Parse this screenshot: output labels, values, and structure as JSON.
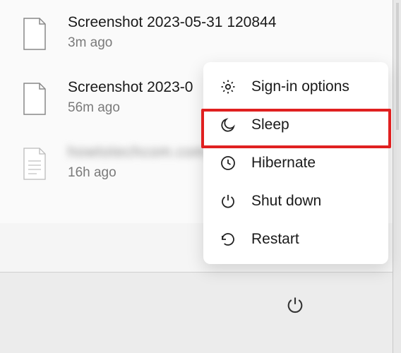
{
  "files": [
    {
      "name": "Screenshot 2023-05-31 120844",
      "time": "3m ago",
      "blurred": false
    },
    {
      "name": "Screenshot 2023-0",
      "time": "56m ago",
      "blurred": false
    },
    {
      "name": "howtotechcom.com",
      "time": "16h ago",
      "blurred": true
    }
  ],
  "power_menu": {
    "items": [
      {
        "icon": "gear-icon",
        "label": "Sign-in options"
      },
      {
        "icon": "moon-icon",
        "label": "Sleep"
      },
      {
        "icon": "clock-icon",
        "label": "Hibernate"
      },
      {
        "icon": "power-icon",
        "label": "Shut down"
      },
      {
        "icon": "restart-icon",
        "label": "Restart"
      }
    ]
  },
  "highlight_index": 1,
  "colors": {
    "highlight": "#e02020"
  }
}
